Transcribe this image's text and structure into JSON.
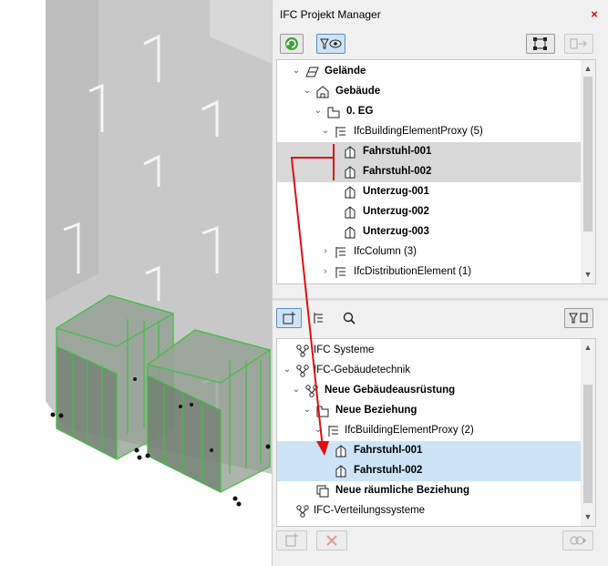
{
  "window": {
    "title": "IFC Projekt Manager",
    "close_glyph": "×"
  },
  "top_toolbar": [
    "refresh-icon",
    "filter-view-icon",
    "select-structure-icon",
    "disconnect-icon"
  ],
  "top_tree": [
    {
      "label": "Gelände",
      "bold": true,
      "expanded": true,
      "icon": "site-icon"
    },
    {
      "label": "Gebäude",
      "bold": true,
      "expanded": true,
      "icon": "building-icon"
    },
    {
      "label": "0. EG",
      "bold": true,
      "expanded": true,
      "icon": "storey-icon"
    },
    {
      "label": "IfcBuildingElementProxy (5)",
      "bold": false,
      "expanded": true,
      "icon": "type-group-icon"
    },
    {
      "label": "Fahrstuhl-001",
      "bold": true,
      "icon": "element-icon",
      "selected": true
    },
    {
      "label": "Fahrstuhl-002",
      "bold": true,
      "icon": "element-icon",
      "selected": true
    },
    {
      "label": "Unterzug-001",
      "bold": true,
      "icon": "element-icon"
    },
    {
      "label": "Unterzug-002",
      "bold": true,
      "icon": "element-icon"
    },
    {
      "label": "Unterzug-003",
      "bold": true,
      "icon": "element-icon"
    },
    {
      "label": "IfcColumn (3)",
      "bold": false,
      "expanded": false,
      "icon": "type-group-icon"
    },
    {
      "label": "IfcDistributionElement (1)",
      "bold": false,
      "expanded": false,
      "icon": "type-group-icon"
    }
  ],
  "mid_toolbar": [
    "add-to-system-icon",
    "hierarchy-icon",
    "zoom-icon",
    "filter-structure-icon"
  ],
  "bottom_tree": [
    {
      "label": "IFC Systeme",
      "bold": false,
      "icon": "system-icon"
    },
    {
      "label": "IFC-Gebäudetechnik",
      "bold": false,
      "expanded": true,
      "icon": "system-icon"
    },
    {
      "label": "Neue Gebäudeausrüstung",
      "bold": true,
      "expanded": true,
      "icon": "system-icon"
    },
    {
      "label": "Neue Beziehung",
      "bold": true,
      "expanded": true,
      "icon": "relation-icon"
    },
    {
      "label": "IfcBuildingElementProxy (2)",
      "bold": false,
      "expanded": true,
      "icon": "type-group-icon"
    },
    {
      "label": "Fahrstuhl-001",
      "bold": true,
      "icon": "element-icon",
      "selected": true
    },
    {
      "label": "Fahrstuhl-002",
      "bold": true,
      "icon": "element-icon",
      "selected": true
    },
    {
      "label": "Neue räumliche Beziehung",
      "bold": true,
      "icon": "spatial-relation-icon"
    },
    {
      "label": "IFC-Verteilungssysteme",
      "bold": false,
      "icon": "system-icon"
    }
  ],
  "bottom_toolbar": [
    "new-system-icon",
    "delete-icon",
    "link-icon"
  ],
  "colors": {
    "selection_gray": "#d8d8d8",
    "selection_blue": "#cde4f7",
    "arrow_red": "#e01010",
    "elevator_green": "#3ec23e"
  }
}
